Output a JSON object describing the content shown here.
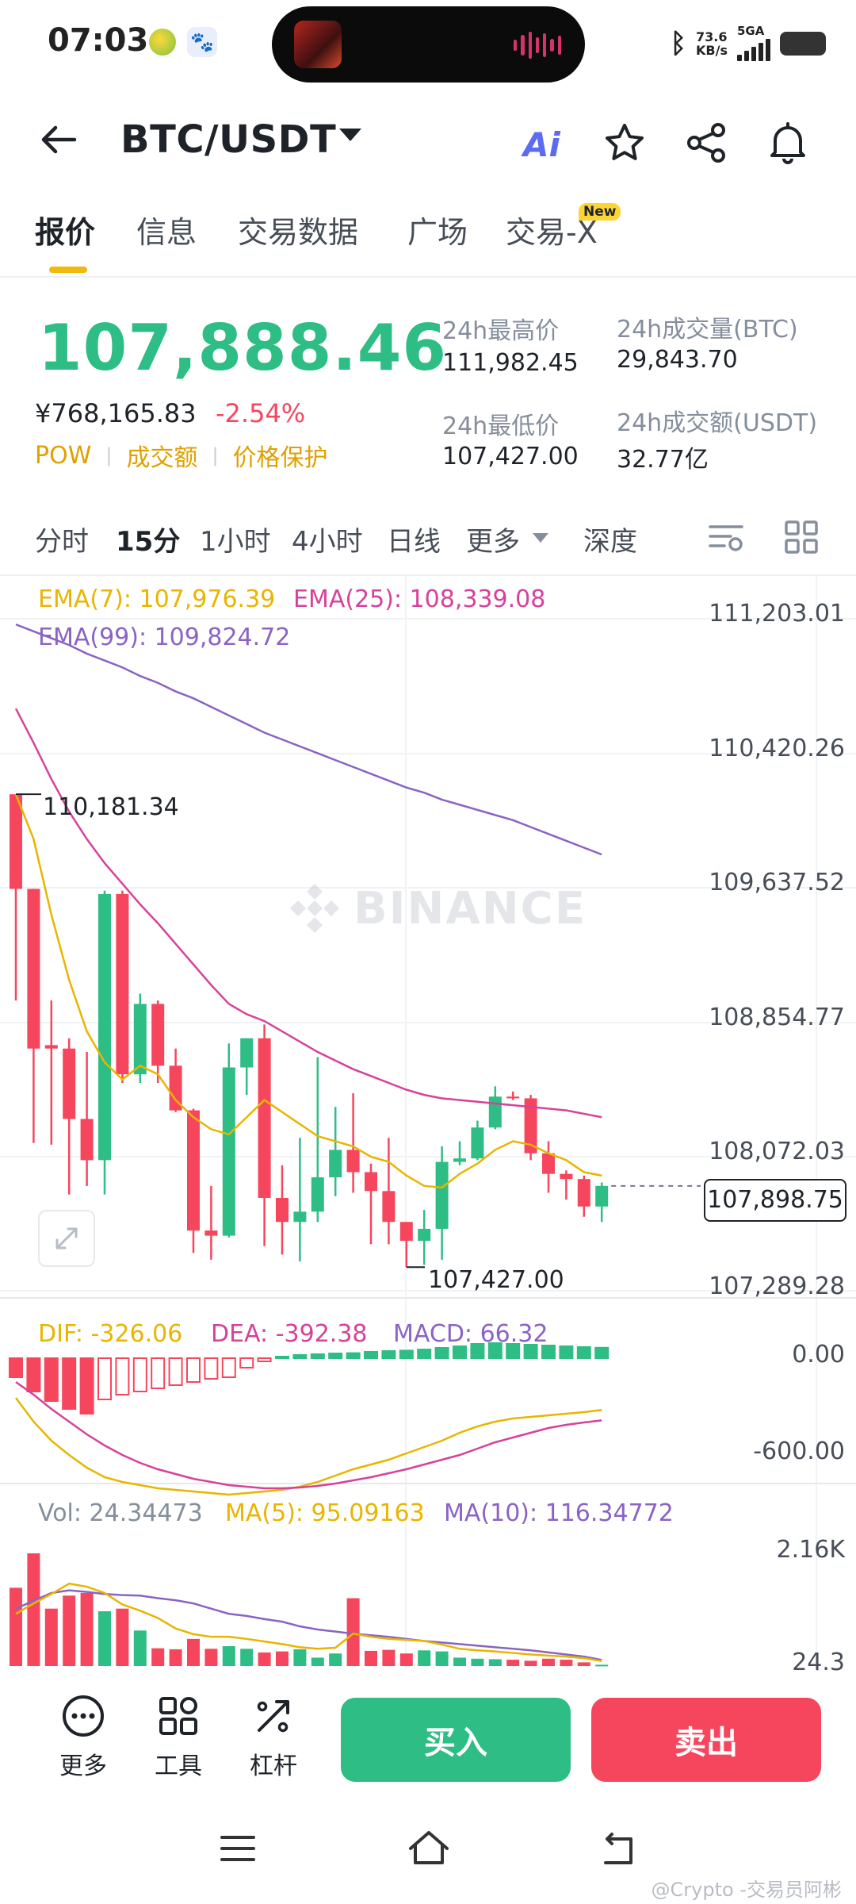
{
  "status_bar": {
    "time": "07:03",
    "net_speed_value": "73.6",
    "net_speed_unit": "KB/s",
    "network": "5GA"
  },
  "header": {
    "pair": "BTC/USDT",
    "ai_label": "Ai"
  },
  "tabs": [
    {
      "label": "报价",
      "active": true
    },
    {
      "label": "信息"
    },
    {
      "label": "交易数据"
    },
    {
      "label": "广场"
    },
    {
      "label": "交易-X",
      "badge": "New"
    }
  ],
  "ticker": {
    "last_price": "107,888.46",
    "cny_price": "¥768,165.83",
    "change_pct": "-2.54%",
    "tags": [
      "POW",
      "成交额",
      "价格保护"
    ],
    "high_label": "24h最高价",
    "high": "111,982.45",
    "low_label": "24h最低价",
    "low": "107,427.00",
    "vol_btc_label": "24h成交量(BTC)",
    "vol_btc": "29,843.70",
    "vol_usdt_label": "24h成交额(USDT)",
    "vol_usdt": "32.77亿"
  },
  "intervals": [
    "分时",
    "15分",
    "1小时",
    "4小时",
    "日线",
    "更多",
    "深度"
  ],
  "active_interval": "15分",
  "chart": {
    "watermark": "BINANCE",
    "ema_labels": {
      "ema7": "EMA(7): 107,976.39",
      "ema25": "EMA(25): 108,339.08",
      "ema99": "EMA(99): 109,824.72"
    },
    "price_axis": [
      "111,203.01",
      "110,420.26",
      "109,637.52",
      "108,854.77",
      "108,072.03",
      "107,289.28"
    ],
    "current_price_tag": "107,898.75",
    "high_marker": "110,181.34",
    "low_marker": "107,427.00",
    "macd_labels": {
      "dif": "DIF: -326.06",
      "dea": "DEA: -392.38",
      "macd": "MACD: 66.32"
    },
    "macd_axis": [
      "0.00",
      "-600.00"
    ],
    "vol_labels": {
      "vol": "Vol: 24.34473",
      "ma5": "MA(5): 95.09163",
      "ma10": "MA(10): 116.34772"
    },
    "vol_axis": [
      "2.16K",
      "24.3"
    ],
    "colors": {
      "up": "#2ebd85",
      "down": "#f6465d",
      "ema7": "#e8b500",
      "ema25": "#d6429a",
      "ema99": "#8a63c5"
    }
  },
  "chart_data": {
    "type": "candlestick",
    "interval": "15分",
    "candles": [
      {
        "o": 110181,
        "h": 110181,
        "l": 108980,
        "c": 109630
      },
      {
        "o": 109630,
        "h": 109630,
        "l": 108150,
        "c": 108700
      },
      {
        "o": 108720,
        "h": 108980,
        "l": 108140,
        "c": 108700
      },
      {
        "o": 108700,
        "h": 108760,
        "l": 107850,
        "c": 108290
      },
      {
        "o": 108290,
        "h": 108680,
        "l": 107900,
        "c": 108050
      },
      {
        "o": 108050,
        "h": 109620,
        "l": 107850,
        "c": 109600
      },
      {
        "o": 109600,
        "h": 109620,
        "l": 108500,
        "c": 108550
      },
      {
        "o": 108550,
        "h": 109020,
        "l": 108500,
        "c": 108960
      },
      {
        "o": 108960,
        "h": 108980,
        "l": 108500,
        "c": 108600
      },
      {
        "o": 108600,
        "h": 108700,
        "l": 108330,
        "c": 108340
      },
      {
        "o": 108340,
        "h": 108350,
        "l": 107510,
        "c": 107640
      },
      {
        "o": 107640,
        "h": 107900,
        "l": 107470,
        "c": 107610
      },
      {
        "o": 107610,
        "h": 108730,
        "l": 107600,
        "c": 108590
      },
      {
        "o": 108590,
        "h": 108760,
        "l": 108430,
        "c": 108760
      },
      {
        "o": 108760,
        "h": 108840,
        "l": 107550,
        "c": 107830
      },
      {
        "o": 107830,
        "h": 108020,
        "l": 107500,
        "c": 107690
      },
      {
        "o": 107690,
        "h": 108180,
        "l": 107460,
        "c": 107750
      },
      {
        "o": 107750,
        "h": 108650,
        "l": 107690,
        "c": 107950
      },
      {
        "o": 107950,
        "h": 108360,
        "l": 107840,
        "c": 108110
      },
      {
        "o": 108110,
        "h": 108440,
        "l": 107860,
        "c": 107980
      },
      {
        "o": 107980,
        "h": 108030,
        "l": 107560,
        "c": 107870
      },
      {
        "o": 107870,
        "h": 108180,
        "l": 107560,
        "c": 107690
      },
      {
        "o": 107690,
        "h": 107690,
        "l": 107427,
        "c": 107580
      },
      {
        "o": 107580,
        "h": 107760,
        "l": 107440,
        "c": 107650
      },
      {
        "o": 107650,
        "h": 108130,
        "l": 107470,
        "c": 108040
      },
      {
        "o": 108040,
        "h": 108160,
        "l": 108020,
        "c": 108060
      },
      {
        "o": 108060,
        "h": 108280,
        "l": 108050,
        "c": 108240
      },
      {
        "o": 108240,
        "h": 108480,
        "l": 108230,
        "c": 108420
      },
      {
        "o": 108420,
        "h": 108450,
        "l": 108400,
        "c": 108410
      },
      {
        "o": 108410,
        "h": 108430,
        "l": 108050,
        "c": 108090
      },
      {
        "o": 108090,
        "h": 108160,
        "l": 107860,
        "c": 107970
      },
      {
        "o": 107970,
        "h": 107990,
        "l": 107820,
        "c": 107940
      },
      {
        "o": 107940,
        "h": 107960,
        "l": 107720,
        "c": 107780
      },
      {
        "o": 107780,
        "h": 107920,
        "l": 107690,
        "c": 107900
      }
    ],
    "ema7": [
      110181,
      109920,
      109480,
      109100,
      108800,
      108620,
      108520,
      108600,
      108550,
      108400,
      108300,
      108230,
      108200,
      108300,
      108400,
      108330,
      108260,
      108190,
      108160,
      108130,
      108070,
      108040,
      107960,
      107900,
      107890,
      107970,
      108030,
      108110,
      108160,
      108140,
      108090,
      108050,
      107980,
      107960
    ],
    "ema25": [
      110680,
      110480,
      110270,
      110080,
      109920,
      109780,
      109660,
      109540,
      109430,
      109310,
      109190,
      109070,
      108960,
      108900,
      108860,
      108800,
      108740,
      108680,
      108630,
      108580,
      108540,
      108500,
      108460,
      108430,
      108410,
      108400,
      108390,
      108380,
      108370,
      108360,
      108350,
      108340,
      108320,
      108300
    ],
    "ema99": [
      111170,
      111130,
      111090,
      111050,
      111000,
      110960,
      110920,
      110870,
      110830,
      110780,
      110740,
      110690,
      110640,
      110590,
      110540,
      110500,
      110460,
      110420,
      110380,
      110340,
      110300,
      110260,
      110220,
      110190,
      110150,
      110120,
      110090,
      110060,
      110030,
      109990,
      109950,
      109910,
      109870,
      109830
    ],
    "macd_hist": [
      -120,
      -210,
      -270,
      -320,
      -350,
      -260,
      -230,
      -210,
      -190,
      -170,
      -150,
      -130,
      -120,
      -60,
      -20,
      10,
      20,
      25,
      30,
      32,
      40,
      45,
      48,
      55,
      65,
      75,
      90,
      95,
      90,
      85,
      80,
      75,
      70,
      66
    ],
    "dif": [
      -250,
      -400,
      -520,
      -610,
      -690,
      -750,
      -780,
      -800,
      -820,
      -830,
      -840,
      -850,
      -860,
      -850,
      -840,
      -830,
      -810,
      -780,
      -740,
      -700,
      -670,
      -640,
      -600,
      -560,
      -520,
      -470,
      -430,
      -400,
      -380,
      -370,
      -360,
      -350,
      -340,
      -326
    ],
    "dea": [
      -150,
      -230,
      -320,
      -400,
      -480,
      -550,
      -610,
      -660,
      -700,
      -730,
      -760,
      -780,
      -800,
      -810,
      -820,
      -820,
      -815,
      -805,
      -790,
      -770,
      -750,
      -725,
      -700,
      -670,
      -640,
      -610,
      -570,
      -530,
      -500,
      -470,
      -440,
      -420,
      -405,
      -392
    ],
    "volume": [
      1500,
      2160,
      1100,
      1350,
      1400,
      1050,
      1100,
      680,
      340,
      320,
      520,
      330,
      380,
      330,
      260,
      280,
      320,
      160,
      240,
      1300,
      290,
      310,
      240,
      300,
      280,
      160,
      140,
      130,
      120,
      100,
      140,
      120,
      70,
      24
    ],
    "vol_ma5": [
      1000,
      1200,
      1380,
      1580,
      1520,
      1400,
      1180,
      1060,
      920,
      720,
      610,
      560,
      560,
      520,
      470,
      420,
      360,
      330,
      350,
      620,
      560,
      520,
      500,
      480,
      410,
      330,
      300,
      280,
      250,
      220,
      200,
      180,
      150,
      95
    ],
    "vol_ma10": [
      1100,
      1250,
      1400,
      1450,
      1420,
      1380,
      1360,
      1350,
      1300,
      1260,
      1200,
      1100,
      1000,
      960,
      900,
      850,
      760,
      700,
      660,
      620,
      590,
      560,
      520,
      480,
      450,
      420,
      390,
      360,
      330,
      300,
      260,
      220,
      180,
      116
    ]
  },
  "bottom_bar": {
    "items": [
      "更多",
      "工具",
      "杠杆"
    ],
    "buy": "买入",
    "sell": "卖出"
  },
  "footer_watermark": "@Crypto -交易员阿彬"
}
